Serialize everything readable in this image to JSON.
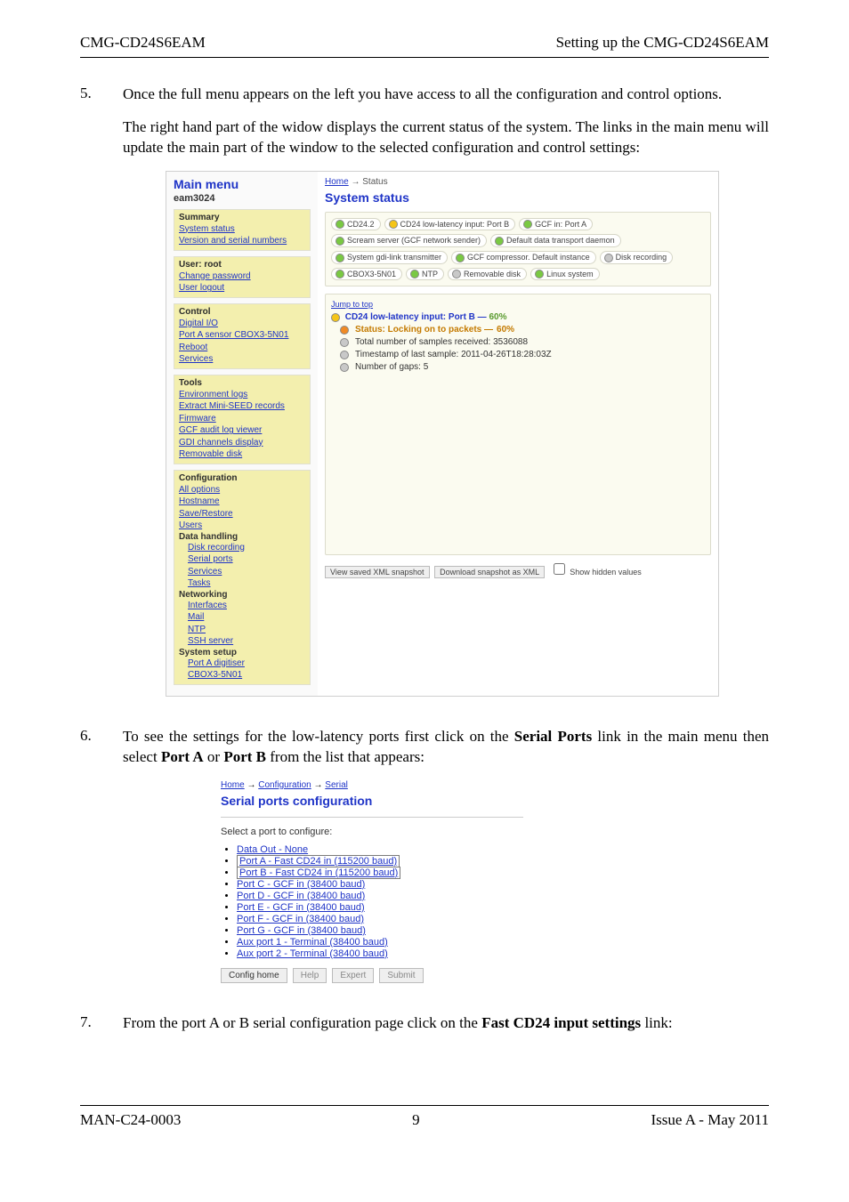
{
  "header": {
    "left": "CMG-CD24S6EAM",
    "right": "Setting up the CMG-CD24S6EAM"
  },
  "step5": {
    "num": "5.",
    "p1": "Once the full menu appears on the left you have access to all the configuration and control options.",
    "p2": "The right hand part of the widow displays the current status of the system.  The links in the main menu will update the main part of the window to the selected configuration and control settings:"
  },
  "menu": {
    "main_title": "Main menu",
    "host": "eam3024",
    "summary": {
      "title": "Summary",
      "items": [
        "System status",
        "Version and serial numbers"
      ]
    },
    "user": {
      "title": "User: root",
      "items": [
        "Change password",
        "User logout"
      ]
    },
    "control": {
      "title": "Control",
      "items": [
        "Digital I/O",
        "Port A sensor CBOX3-5N01",
        "Reboot",
        "Services"
      ]
    },
    "tools": {
      "title": "Tools",
      "items": [
        "Environment logs",
        "Extract Mini-SEED records",
        "Firmware",
        "GCF audit log viewer",
        "GDI channels display",
        "Removable disk"
      ]
    },
    "config": {
      "title": "Configuration",
      "top": [
        "All options",
        "Hostname",
        "Save/Restore",
        "Users"
      ],
      "dh_title": "Data handling",
      "dh": [
        "Disk recording",
        "Serial ports",
        "Services",
        "Tasks"
      ],
      "nw_title": "Networking",
      "nw": [
        "Interfaces",
        "Mail",
        "NTP",
        "SSH server"
      ],
      "ss_title": "System setup",
      "ss": [
        "Port A digitiser",
        "CBOX3-5N01"
      ]
    }
  },
  "mainpane": {
    "crumb_home": "Home",
    "crumb_sep": " → ",
    "crumb_cur": "Status",
    "title": "System status",
    "pills": [
      {
        "led": "green",
        "label": "CD24.2"
      },
      {
        "led": "yellow",
        "label": "CD24 low-latency input: Port B"
      },
      {
        "led": "green",
        "label": "GCF in: Port A"
      },
      {
        "led": "green",
        "label": "Scream server (GCF network sender)"
      },
      {
        "led": "green",
        "label": "Default data transport daemon"
      },
      {
        "led": "green",
        "label": "System gdi-link transmitter"
      },
      {
        "led": "green",
        "label": "GCF compressor. Default instance"
      },
      {
        "led": "gray",
        "label": "Disk recording"
      },
      {
        "led": "green",
        "label": "CBOX3-5N01"
      },
      {
        "led": "green",
        "label": "NTP"
      },
      {
        "led": "gray",
        "label": "Removable disk"
      },
      {
        "led": "green",
        "label": "Linux system"
      }
    ],
    "jump": "Jump to top",
    "stat_title_pre": "CD24 low-latency input: Port B — ",
    "stat_title_pct": "60%",
    "lines": [
      {
        "led": "orange",
        "text_pre": "Status: Locking on to packets — ",
        "pct": "60%"
      },
      {
        "led": "gray",
        "text": "Total number of samples received: 3536088"
      },
      {
        "led": "gray",
        "text": "Timestamp of last sample: 2011-04-26T18:28:03Z"
      },
      {
        "led": "gray",
        "text": "Number of gaps: 5"
      }
    ],
    "foot": {
      "b1": "View saved XML snapshot",
      "b2": "Download snapshot as XML",
      "cb": "Show hidden values"
    }
  },
  "step6": {
    "num": "6.",
    "p_pre": "To see the settings for the low-latency ports first click on the ",
    "b1": "Serial Ports",
    "p_mid": " link in the main menu then select ",
    "b2": "Port A",
    "p_or": " or ",
    "b3": "Port B",
    "p_post": " from the list that appears:"
  },
  "serial": {
    "crumb": {
      "home": "Home",
      "conf": "Configuration",
      "ser": "Serial",
      "sep": " → "
    },
    "title": "Serial ports configuration",
    "select": "Select a port to configure:",
    "items": [
      {
        "text": "Data Out - None",
        "boxed": false
      },
      {
        "text": "Port A - Fast CD24 in (115200 baud)",
        "boxed": true
      },
      {
        "text": "Port B - Fast CD24 in (115200 baud)",
        "boxed": true
      },
      {
        "text": "Port C - GCF in (38400 baud)",
        "boxed": false
      },
      {
        "text": "Port D - GCF in (38400 baud)",
        "boxed": false
      },
      {
        "text": "Port E - GCF in (38400 baud)",
        "boxed": false
      },
      {
        "text": "Port F - GCF in (38400 baud)",
        "boxed": false
      },
      {
        "text": "Port G - GCF in (38400 baud)",
        "boxed": false
      },
      {
        "text": "Aux port 1 - Terminal (38400 baud)",
        "boxed": false
      },
      {
        "text": "Aux port 2 - Terminal (38400 baud)",
        "boxed": false
      }
    ],
    "buttons": {
      "home": "Config home",
      "help": "Help",
      "expert": "Expert",
      "submit": "Submit"
    }
  },
  "step7": {
    "num": "7.",
    "p_pre": "From the port A or B serial configuration page click on the ",
    "b1": "Fast CD24 input settings",
    "p_post": " link:"
  },
  "footer": {
    "left": "MAN-C24-0003",
    "center": "9",
    "right": "Issue A  - May 2011"
  }
}
